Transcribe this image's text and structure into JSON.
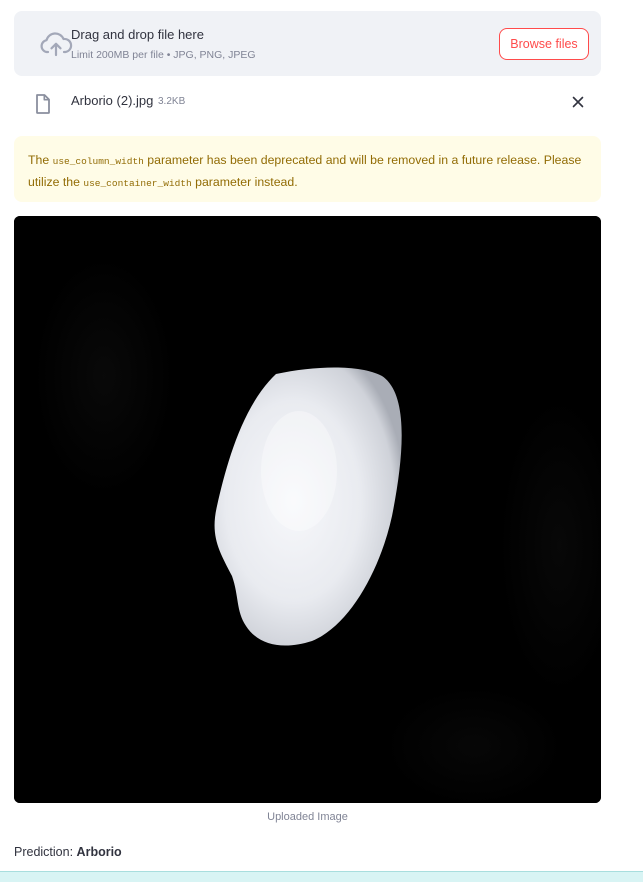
{
  "uploader": {
    "title": "Drag and drop file here",
    "limit_text": "Limit 200MB per file • JPG, PNG, JPEG",
    "browse_label": "Browse files",
    "icon": "cloud-upload-icon"
  },
  "uploaded_file": {
    "name": "Arborio (2).jpg",
    "size": "3.2KB",
    "icon": "file-icon",
    "remove_icon": "close-icon"
  },
  "warning": {
    "text_1": "The",
    "code_1": "use_column_width",
    "text_2": "parameter has been deprecated and will be removed in a future release. Please utilize the",
    "code_2": "use_container_width",
    "text_3": "parameter instead.",
    "color": "#926c05",
    "background": "#fffce7"
  },
  "image": {
    "caption": "Uploaded Image"
  },
  "prediction": {
    "label": "Prediction:",
    "value": "Arborio"
  },
  "colors": {
    "accent": "#ff4b4b",
    "text": "#31333f",
    "muted": "#808495",
    "panel": "#f0f2f6"
  }
}
